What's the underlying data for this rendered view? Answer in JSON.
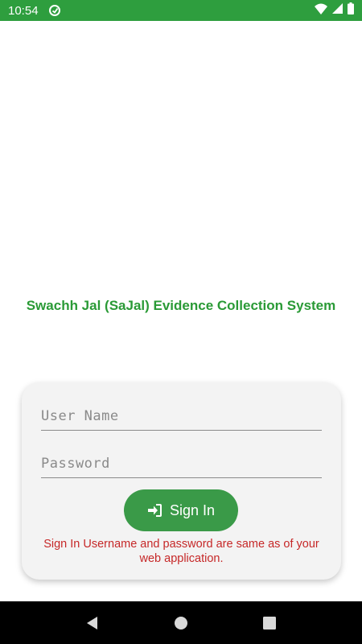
{
  "status_bar": {
    "time": "10:54",
    "icons": [
      "app-notification-icon",
      "wifi-icon",
      "signal-icon",
      "battery-icon"
    ]
  },
  "app": {
    "title": "Swachh Jal (SaJal) Evidence Collection System",
    "accent_color": "#2e9e3e"
  },
  "login": {
    "username_placeholder": "User Name",
    "username_value": "",
    "password_placeholder": "Password",
    "password_value": "",
    "sign_in_label": "Sign In",
    "sign_in_icon": "sign-in-icon",
    "note": "Sign In Username and password are same as of your web application.",
    "note_color": "#c62828"
  },
  "nav_bar": {
    "buttons": [
      "back-icon",
      "home-icon",
      "recents-icon"
    ]
  }
}
